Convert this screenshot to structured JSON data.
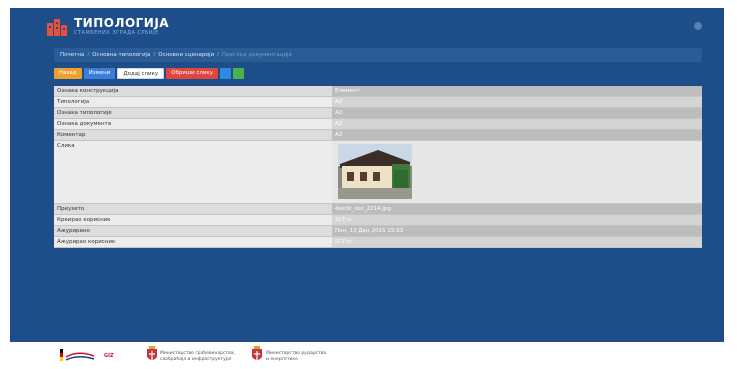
{
  "header": {
    "title": "ТИПОЛОГИЈА",
    "subtitle": "СТАМБЕНИХ ЗГРАДА СРБИЈЕ"
  },
  "breadcrumb": {
    "items": [
      "Почетна",
      "Основна типологија",
      "Основни сценарији"
    ],
    "current": "Преглед документације"
  },
  "toolbar": {
    "buttons": [
      "Назад",
      "Измени",
      "Додај слику",
      "Обриши слику"
    ]
  },
  "details": {
    "rows": [
      {
        "label": "Ознака конструкција",
        "value": "Елемент"
      },
      {
        "label": "Типологија",
        "value": "A2"
      },
      {
        "label": "Ознака типологије",
        "value": "A2"
      },
      {
        "label": "Ознака документа",
        "value": "A2"
      },
      {
        "label": "Коментар",
        "value": "A2"
      },
      {
        "label": "Слика",
        "value": ""
      },
      {
        "label": "Преузето",
        "value": "4ae3c_dsc_2214.jpg"
      },
      {
        "label": "Креирао корисник",
        "value": "SCF.rs"
      },
      {
        "label": "Ажурирано",
        "value": "Пон, 13 Дец 2015 15:33"
      },
      {
        "label": "Ажурирао корисник",
        "value": "SCF.rs"
      }
    ]
  },
  "footer": {
    "partner1": "GIZ",
    "ministry1_line1": "Министарство грађевинарства,",
    "ministry1_line2": "саобраћаја и инфраструктуре",
    "ministry2_line1": "Министарство рударства",
    "ministry2_line2": "и енергетике"
  },
  "colors": {
    "app_background": "#1d4e89",
    "breadcrumb_bar": "#2a5c97",
    "button_back": "#f0a030",
    "button_edit": "#3b7dd8",
    "button_delete_image": "#e0453f",
    "button_square_blue": "#2f8be0",
    "button_square_green": "#4cb050"
  },
  "icons": {
    "logo": "building-logo-icon",
    "menu": "menu-dot-icon",
    "square_button_1": "info-icon",
    "square_button_2": "add-icon",
    "photo": "house-photo"
  }
}
